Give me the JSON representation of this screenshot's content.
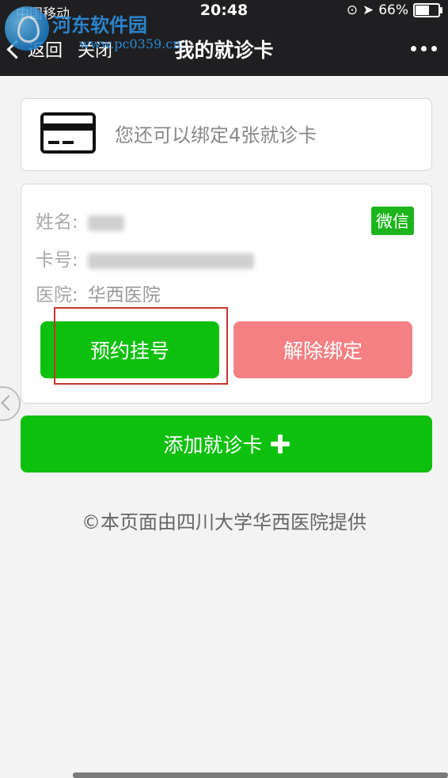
{
  "status_bar": {
    "carrier": "中国移动",
    "time": "20:48",
    "battery": "66%",
    "battery_level": 0.66
  },
  "watermark": {
    "site_name": "河东软件园",
    "url": "www.pc0359.cn"
  },
  "nav": {
    "back_label": "返回",
    "close_label": "关闭",
    "title": "我的就诊卡"
  },
  "bind_tip": {
    "text": "您还可以绑定4张就诊卡"
  },
  "card_info": {
    "name_label": "姓名:",
    "card_no_label": "卡号:",
    "hospital_label": "医院:",
    "hospital_value": "华西医院",
    "badge": "微信"
  },
  "actions": {
    "book_label": "预约挂号",
    "unbind_label": "解除绑定",
    "add_card_label": "添加就诊卡"
  },
  "footer": {
    "text": "©本页面由四川大学华西医院提供"
  },
  "colors": {
    "primary_green": "#0ec00e",
    "danger_pink": "#f58083",
    "nav_bg": "#1f1f21",
    "highlight_red": "#c8342d"
  }
}
